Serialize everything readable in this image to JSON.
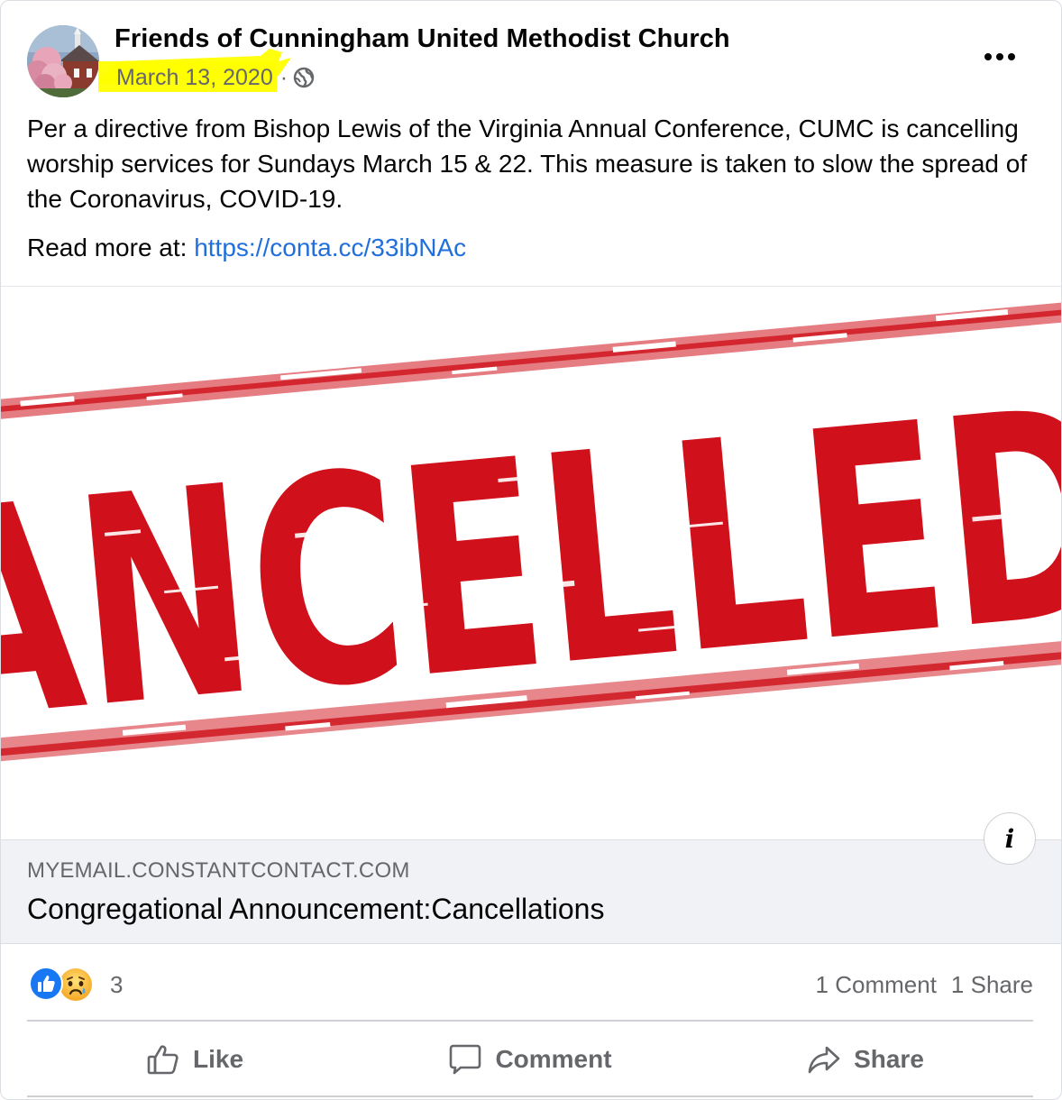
{
  "post": {
    "page_name": "Friends of Cunningham United Methodist Church",
    "date": "March 13, 2020",
    "separator": "·",
    "privacy_icon": "globe-icon",
    "more_icon": "ellipsis-icon",
    "message": "Per a directive from Bishop Lewis of the Virginia Annual Conference, CUMC is cancelling worship services for Sundays March 15 & 22.  This measure is taken to slow the spread of the Coronavirus, COVID-19.",
    "read_more_prefix": "Read more at: ",
    "read_more_link": "https://conta.cc/33ibNAc"
  },
  "image": {
    "stamp_text": "ANCELLED",
    "stamp_color": "#d0101a",
    "info_label": "i"
  },
  "link_preview": {
    "domain": "MYEMAIL.CONSTANTCONTACT.COM",
    "title": "Congregational Announcement:Cancellations"
  },
  "engagement": {
    "reaction_icons": [
      "like-icon",
      "sad-icon"
    ],
    "reaction_count": "3",
    "comments": "1 Comment",
    "shares": "1 Share"
  },
  "actions": {
    "like": "Like",
    "comment": "Comment",
    "share": "Share"
  },
  "colors": {
    "link": "#216fdb",
    "highlight": "#ffff00",
    "like_blue": "#1877f2",
    "secondary_text": "#65676b"
  }
}
